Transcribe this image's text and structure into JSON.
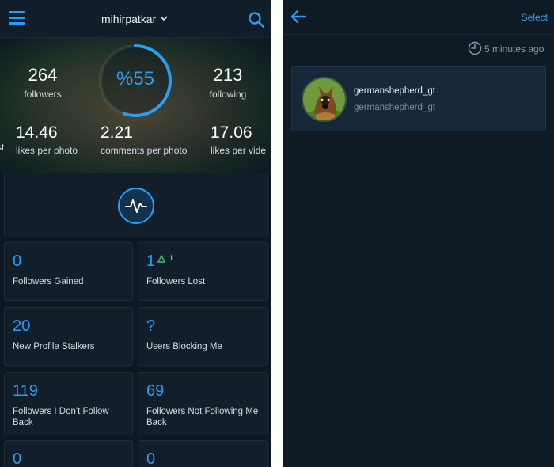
{
  "left": {
    "header": {
      "username": "mihirpatkar"
    },
    "stats": {
      "followers": {
        "value": "264",
        "label": "followers"
      },
      "following": {
        "value": "213",
        "label": "following"
      },
      "gauge": {
        "text": "%55",
        "percent": 55
      },
      "partial_left_label": "st",
      "likes_per_photo": {
        "value": "14.46",
        "label": "likes per photo"
      },
      "comments_per_photo": {
        "value": "2.21",
        "label": "comments per photo"
      },
      "likes_per_video": {
        "value": "17.06",
        "label": "likes per vide"
      }
    },
    "tiles": [
      {
        "value": "0",
        "label": "Followers Gained"
      },
      {
        "value": "1",
        "label": "Followers Lost",
        "delta": "1"
      },
      {
        "value": "20",
        "label": "New Profile Stalkers"
      },
      {
        "value": "?",
        "label": "Users Blocking Me"
      },
      {
        "value": "119",
        "label": "Followers I Don't Follow Back"
      },
      {
        "value": "69",
        "label": "Followers Not Following Me Back"
      },
      {
        "value": "0",
        "label": ""
      },
      {
        "value": "0",
        "label": ""
      }
    ],
    "colors": {
      "accent": "#2a9df4",
      "delta_up": "#3fbf6a"
    }
  },
  "right": {
    "header": {
      "select_label": "Select"
    },
    "timestamp": "5 minutes ago",
    "user": {
      "name": "germanshepherd_gt",
      "handle": "germanshepherd_gt"
    }
  }
}
